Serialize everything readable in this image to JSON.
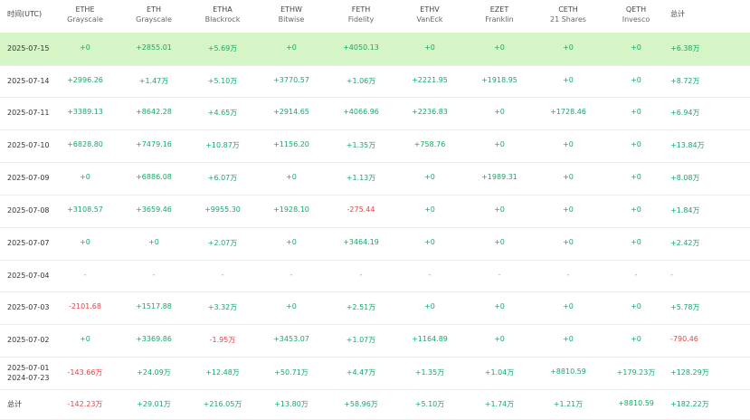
{
  "colors": {
    "positive": "#18a86b",
    "negative": "#e0474c",
    "highlight": "#d6f5c7"
  },
  "header": {
    "date_label": "时间(UTC)",
    "total_label": "总计",
    "funds": [
      {
        "ticker": "ETHE",
        "issuer": "Grayscale"
      },
      {
        "ticker": "ETH",
        "issuer": "Grayscale"
      },
      {
        "ticker": "ETHA",
        "issuer": "Blackrock"
      },
      {
        "ticker": "ETHW",
        "issuer": "Bitwise"
      },
      {
        "ticker": "FETH",
        "issuer": "Fidelity"
      },
      {
        "ticker": "ETHV",
        "issuer": "VanEck"
      },
      {
        "ticker": "EZET",
        "issuer": "Franklin"
      },
      {
        "ticker": "CETH",
        "issuer": "21 Shares"
      },
      {
        "ticker": "QETH",
        "issuer": "Invesco"
      }
    ]
  },
  "rows": [
    {
      "date": "2025-07-15",
      "values": [
        "+0",
        "+2855.01",
        "+5.69万",
        "+0",
        "+4050.13",
        "+0",
        "+0",
        "+0",
        "+0"
      ],
      "total": "+6.38万",
      "highlight": true
    },
    {
      "date": "2025-07-14",
      "values": [
        "+2996.26",
        "+1.47万",
        "+5.10万",
        "+3770.57",
        "+1.06万",
        "+2221.95",
        "+1918.95",
        "+0",
        "+0"
      ],
      "total": "+8.72万"
    },
    {
      "date": "2025-07-11",
      "values": [
        "+3389.13",
        "+8642.28",
        "+4.65万",
        "+2914.65",
        "+4066.96",
        "+2236.83",
        "+0",
        "+1728.46",
        "+0"
      ],
      "total": "+6.94万"
    },
    {
      "date": "2025-07-10",
      "values": [
        "+6828.80",
        "+7479.16",
        "+10.87万",
        "+1156.20",
        "+1.35万",
        "+758.76",
        "+0",
        "+0",
        "+0"
      ],
      "total": "+13.84万"
    },
    {
      "date": "2025-07-09",
      "values": [
        "+0",
        "+6886.08",
        "+6.07万",
        "+0",
        "+1.13万",
        "+0",
        "+1989.31",
        "+0",
        "+0"
      ],
      "total": "+8.08万"
    },
    {
      "date": "2025-07-08",
      "values": [
        "+3108.57",
        "+3659.46",
        "+9955.30",
        "+1928.10",
        "-275.44",
        "+0",
        "+0",
        "+0",
        "+0"
      ],
      "total": "+1.84万"
    },
    {
      "date": "2025-07-07",
      "values": [
        "+0",
        "+0",
        "+2.07万",
        "+0",
        "+3464.19",
        "+0",
        "+0",
        "+0",
        "+0"
      ],
      "total": "+2.42万"
    },
    {
      "date": "2025-07-04",
      "values": [
        "-",
        "-",
        "-",
        "-",
        "-",
        "-",
        "-",
        "-",
        "-"
      ],
      "total": "-"
    },
    {
      "date": "2025-07-03",
      "values": [
        "-2101.68",
        "+1517.88",
        "+3.32万",
        "+0",
        "+2.51万",
        "+0",
        "+0",
        "+0",
        "+0"
      ],
      "total": "+5.78万"
    },
    {
      "date": "2025-07-02",
      "values": [
        "+0",
        "+3369.86",
        "-1.95万",
        "+3453.07",
        "+1.07万",
        "+1164.89",
        "+0",
        "+0",
        "+0"
      ],
      "total": "-790.46"
    },
    {
      "date": "2025-07-01",
      "date2": "2024-07-23",
      "values": [
        "-143.66万",
        "+24.09万",
        "+12.48万",
        "+50.71万",
        "+4.47万",
        "+1.35万",
        "+1.04万",
        "+8810.59",
        "+179.23万"
      ],
      "total": "+128.29万"
    },
    {
      "date": "总计",
      "values": [
        "-142.23万",
        "+29.01万",
        "+216.05万",
        "+13.80万",
        "+58.96万",
        "+5.10万",
        "+1.74万",
        "+1.21万",
        "+8810.59"
      ],
      "total": "+182.22万"
    }
  ]
}
